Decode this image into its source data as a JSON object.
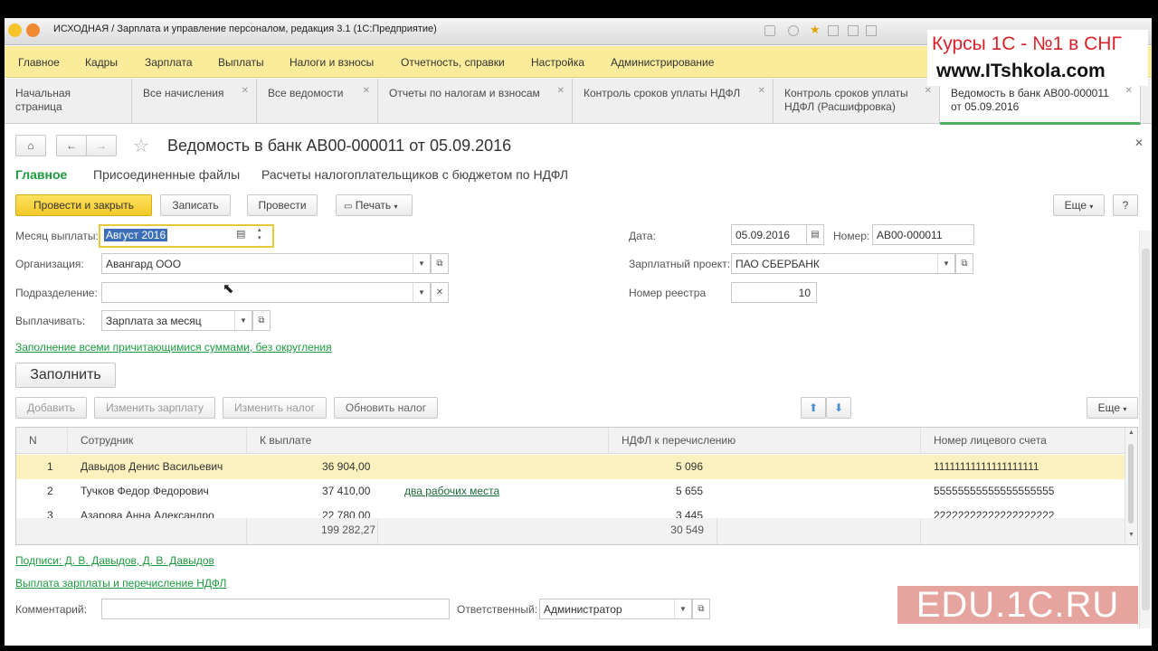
{
  "window": {
    "title": "ИСХОДНАЯ / Зарплата и управление персоналом, редакция 3.1  (1С:Предприятие)"
  },
  "menu": [
    "Главное",
    "Кадры",
    "Зарплата",
    "Выплаты",
    "Налоги и взносы",
    "Отчетность, справки",
    "Настройка",
    "Администрирование"
  ],
  "tabs": [
    {
      "label": "Начальная страница"
    },
    {
      "label": "Все начисления"
    },
    {
      "label": "Все ведомости"
    },
    {
      "label": "Отчеты по налогам и взносам"
    },
    {
      "label": "Контроль сроков уплаты НДФЛ"
    },
    {
      "label": "Контроль сроков уплаты НДФЛ (Расшифровка)"
    },
    {
      "label": "Ведомость в банк АВ00-000011 от 05.09.2016"
    }
  ],
  "doc": {
    "title": "Ведомость в банк АВ00-000011 от 05.09.2016",
    "subnav": [
      "Главное",
      "Присоединенные файлы",
      "Расчеты налогоплательщиков с бюджетом по НДФЛ"
    ]
  },
  "toolbar": {
    "post_close": "Провести и закрыть",
    "write": "Записать",
    "post": "Провести",
    "print": "Печать",
    "more": "Еще",
    "help": "?"
  },
  "form": {
    "month_label": "Месяц выплаты:",
    "month_value": "Август 2016",
    "org_label": "Организация:",
    "org_value": "Авангард ООО",
    "dept_label": "Подразделение:",
    "dept_value": "",
    "pay_label": "Выплачивать:",
    "pay_value": "Зарплата за месяц",
    "date_label": "Дата:",
    "date_value": "05.09.2016",
    "num_label": "Номер:",
    "num_value": "АВ00-000011",
    "project_label": "Зарплатный проект:",
    "project_value": "ПАО СБЕРБАНК",
    "registry_label": "Номер реестра",
    "registry_value": "10",
    "fill_link": "Заполнение всеми причитающимися суммами, без округления",
    "fill_button": "Заполнить"
  },
  "table_toolbar": {
    "add": "Добавить",
    "change_salary": "Изменить зарплату",
    "change_tax": "Изменить налог",
    "update_tax": "Обновить налог",
    "more": "Еще"
  },
  "table": {
    "columns": [
      "N",
      "Сотрудник",
      "К выплате",
      "НДФЛ к перечислению",
      "Номер лицевого счета"
    ],
    "rows": [
      {
        "n": "1",
        "employee": "Давыдов Денис Васильевич",
        "amount": "36 904,00",
        "note": "",
        "tax": "5 096",
        "account": "11111111111111111111"
      },
      {
        "n": "2",
        "employee": "Тучков Федор Федорович",
        "amount": "37 410,00",
        "note": "два рабочих места",
        "tax": "5 655",
        "account": "55555555555555555555"
      },
      {
        "n": "3",
        "employee": "Азарова Анна Александро",
        "amount": "22 780,00",
        "note": "",
        "tax": "3 445",
        "account": "22222222222222222222"
      }
    ],
    "totals": {
      "amount": "199 282,27",
      "tax": "30 549"
    }
  },
  "footer": {
    "signatures_link": "Подписи: Д. В. Давыдов, Д. В. Давыдов",
    "payment_link": "Выплата зарплаты и перечисление НДФЛ",
    "comment_label": "Комментарий:",
    "comment_value": "",
    "responsible_label": "Ответственный:",
    "responsible_value": "Администратор"
  },
  "overlay": {
    "brand_line1": "Курсы 1С - №1 в СНГ",
    "brand_line2": "www.ITshkola.com",
    "watermark": "EDU.1C.RU"
  },
  "colors": {
    "menu_bg": "#fbec9c",
    "accent_green": "#1d9b3f",
    "primary_button": "#f4c92a",
    "selected_row": "#fbf1be"
  }
}
